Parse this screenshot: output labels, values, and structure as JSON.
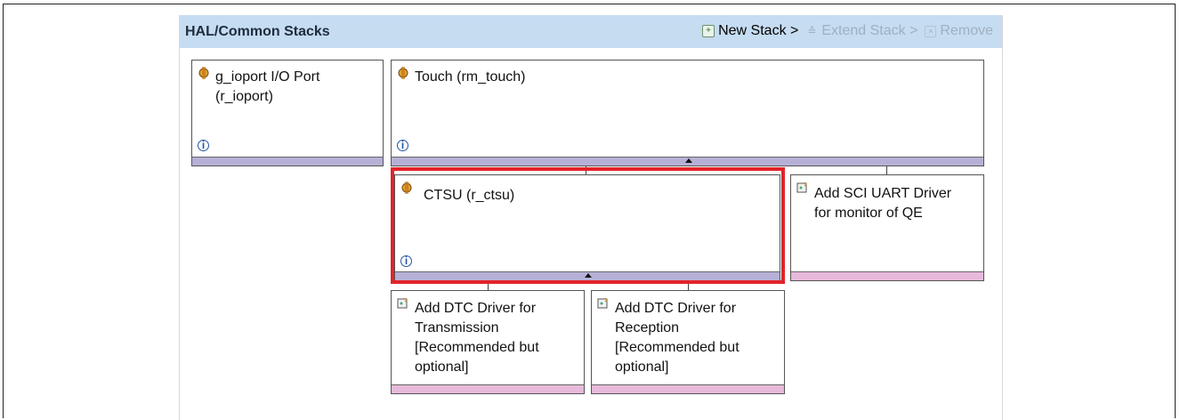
{
  "header": {
    "title": "HAL/Common Stacks",
    "toolbar": {
      "new_stack": "New Stack >",
      "extend_stack": "Extend Stack >",
      "remove": "Remove"
    }
  },
  "blocks": {
    "ioport": {
      "line1": "g_ioport I/O Port",
      "line2": "(r_ioport)"
    },
    "touch": {
      "line1": "Touch (rm_touch)"
    },
    "ctsu": {
      "line1": "CTSU (r_ctsu)"
    },
    "sci_uart": {
      "line1": "Add SCI UART Driver",
      "line2": "for monitor of QE"
    },
    "dtc_tx": {
      "line1": "Add DTC Driver for",
      "line2": "Transmission",
      "line3": "[Recommended but",
      "line4": "optional]"
    },
    "dtc_rx": {
      "line1": "Add DTC Driver for",
      "line2": "Reception",
      "line3": "[Recommended but",
      "line4": "optional]"
    }
  },
  "info_glyph": "i",
  "colors": {
    "selection": "#e3232a",
    "header_bg": "#c5dcf1",
    "bar_lavender": "#b7b0d6",
    "bar_pink": "#e7b9da"
  }
}
